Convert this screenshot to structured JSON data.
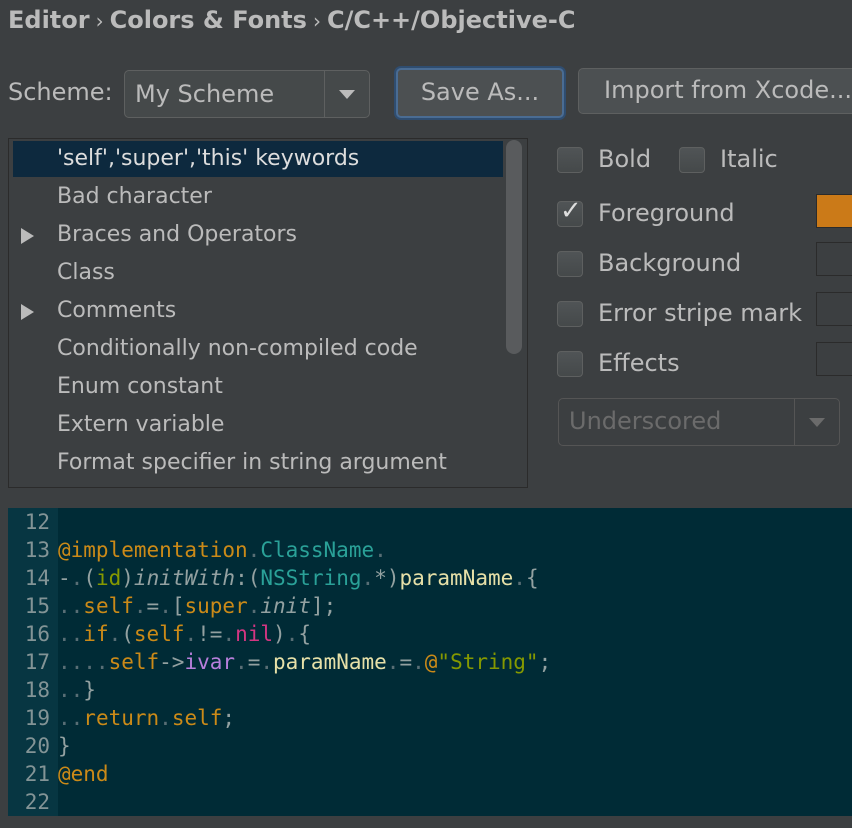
{
  "breadcrumb": {
    "items": [
      "Editor",
      "Colors & Fonts",
      "C/C++/Objective-C"
    ],
    "separator": "›"
  },
  "scheme": {
    "label": "Scheme:",
    "selected": "My Scheme",
    "save_as_label": "Save As...",
    "import_label": "Import from Xcode..."
  },
  "element_list": {
    "items": [
      {
        "label": "'self','super','this' keywords",
        "expandable": false,
        "selected": true
      },
      {
        "label": "Bad character",
        "expandable": false,
        "selected": false
      },
      {
        "label": "Braces and Operators",
        "expandable": true,
        "selected": false
      },
      {
        "label": "Class",
        "expandable": false,
        "selected": false
      },
      {
        "label": "Comments",
        "expandable": true,
        "selected": false
      },
      {
        "label": "Conditionally non-compiled code",
        "expandable": false,
        "selected": false
      },
      {
        "label": "Enum constant",
        "expandable": false,
        "selected": false
      },
      {
        "label": "Extern variable",
        "expandable": false,
        "selected": false
      },
      {
        "label": "Format specifier in string argument",
        "expandable": false,
        "selected": false
      }
    ]
  },
  "attributes": {
    "bold_label": "Bold",
    "italic_label": "Italic",
    "foreground_label": "Foreground",
    "background_label": "Background",
    "error_stripe_label": "Error stripe mark",
    "effects_label": "Effects",
    "effects_type": "Underscored",
    "bold_checked": false,
    "italic_checked": false,
    "foreground_checked": true,
    "background_checked": false,
    "error_stripe_checked": false,
    "effects_checked": false,
    "foreground_color": "#cb7a18"
  },
  "preview": {
    "lines": [
      {
        "n": "12",
        "tokens": []
      },
      {
        "n": "13",
        "tokens": [
          [
            "kw",
            "@implementation"
          ],
          [
            "ws",
            "."
          ],
          [
            "cls",
            "ClassName"
          ],
          [
            "ws",
            "."
          ]
        ]
      },
      {
        "n": "14",
        "tokens": [
          [
            "plain",
            "-"
          ],
          [
            "ws",
            "."
          ],
          [
            "plain",
            "("
          ],
          [
            "id",
            "id"
          ],
          [
            "plain",
            ")"
          ],
          [
            "meth",
            "initWith"
          ],
          [
            "plain",
            ":("
          ],
          [
            "cls",
            "NSString"
          ],
          [
            "ws",
            "."
          ],
          [
            "plain",
            "*)"
          ],
          [
            "param",
            "paramName"
          ],
          [
            "ws",
            "."
          ],
          [
            "plain",
            "{"
          ]
        ]
      },
      {
        "n": "15",
        "tokens": [
          [
            "ws",
            ".."
          ],
          [
            "self",
            "self"
          ],
          [
            "ws",
            "."
          ],
          [
            "plain",
            "="
          ],
          [
            "ws",
            "."
          ],
          [
            "plain",
            "["
          ],
          [
            "self",
            "super"
          ],
          [
            "ws",
            "."
          ],
          [
            "meth",
            "init"
          ],
          [
            "plain",
            "];"
          ]
        ]
      },
      {
        "n": "16",
        "tokens": [
          [
            "ws",
            ".."
          ],
          [
            "kw",
            "if"
          ],
          [
            "ws",
            "."
          ],
          [
            "plain",
            "("
          ],
          [
            "self",
            "self"
          ],
          [
            "ws",
            "."
          ],
          [
            "plain",
            "!="
          ],
          [
            "ws",
            "."
          ],
          [
            "nil",
            "nil"
          ],
          [
            "plain",
            ")"
          ],
          [
            "ws",
            "."
          ],
          [
            "plain",
            "{"
          ]
        ]
      },
      {
        "n": "17",
        "tokens": [
          [
            "ws",
            "...."
          ],
          [
            "self",
            "self"
          ],
          [
            "plain",
            "->"
          ],
          [
            "ivar",
            "ivar"
          ],
          [
            "ws",
            "."
          ],
          [
            "plain",
            "="
          ],
          [
            "ws",
            "."
          ],
          [
            "param",
            "paramName"
          ],
          [
            "ws",
            "."
          ],
          [
            "plain",
            "="
          ],
          [
            "ws",
            "."
          ],
          [
            "kw",
            "@"
          ],
          [
            "str",
            "\"String\""
          ],
          [
            "plain",
            ";"
          ]
        ]
      },
      {
        "n": "18",
        "tokens": [
          [
            "ws",
            ".."
          ],
          [
            "plain",
            "}"
          ]
        ]
      },
      {
        "n": "19",
        "tokens": [
          [
            "ws",
            ".."
          ],
          [
            "kw",
            "return"
          ],
          [
            "ws",
            "."
          ],
          [
            "self",
            "self"
          ],
          [
            "plain",
            ";"
          ]
        ]
      },
      {
        "n": "20",
        "tokens": [
          [
            "plain",
            "}"
          ]
        ]
      },
      {
        "n": "21",
        "tokens": [
          [
            "kw",
            "@end"
          ]
        ]
      },
      {
        "n": "22",
        "tokens": []
      }
    ]
  }
}
